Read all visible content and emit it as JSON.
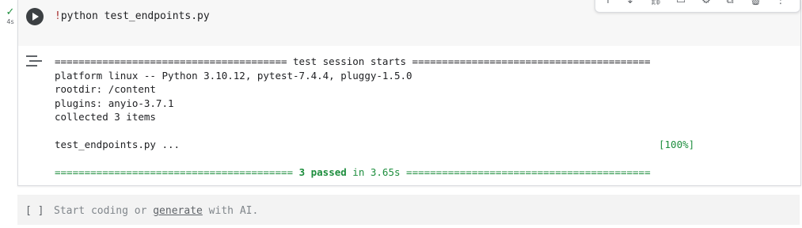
{
  "status": {
    "check": "✓",
    "duration": "4s"
  },
  "cell": {
    "code_prefix": "!",
    "code_rest": "python test_endpoints.py",
    "output_lines": {
      "header": "======================================= test session starts ========================================",
      "platform": "platform linux -- Python 3.10.12, pytest-7.4.4, pluggy-1.5.0",
      "rootdir": "rootdir: /content",
      "plugins": "plugins: anyio-3.7.1",
      "collected": "collected 3 items",
      "test_file": "test_endpoints.py ...",
      "percent": "[100%]",
      "summary_left": "========================================",
      "summary_passed": "3 passed",
      "summary_time": " in 3.65s ",
      "summary_right": "========================================="
    }
  },
  "empty_cell": {
    "brackets": "[ ]",
    "placeholder_start": "Start coding or ",
    "placeholder_link": "generate",
    "placeholder_end": " with AI."
  },
  "colors": {
    "pass": "#1e8e3e",
    "run_button": "#3c4043",
    "code_bg": "#f7f7f7"
  }
}
